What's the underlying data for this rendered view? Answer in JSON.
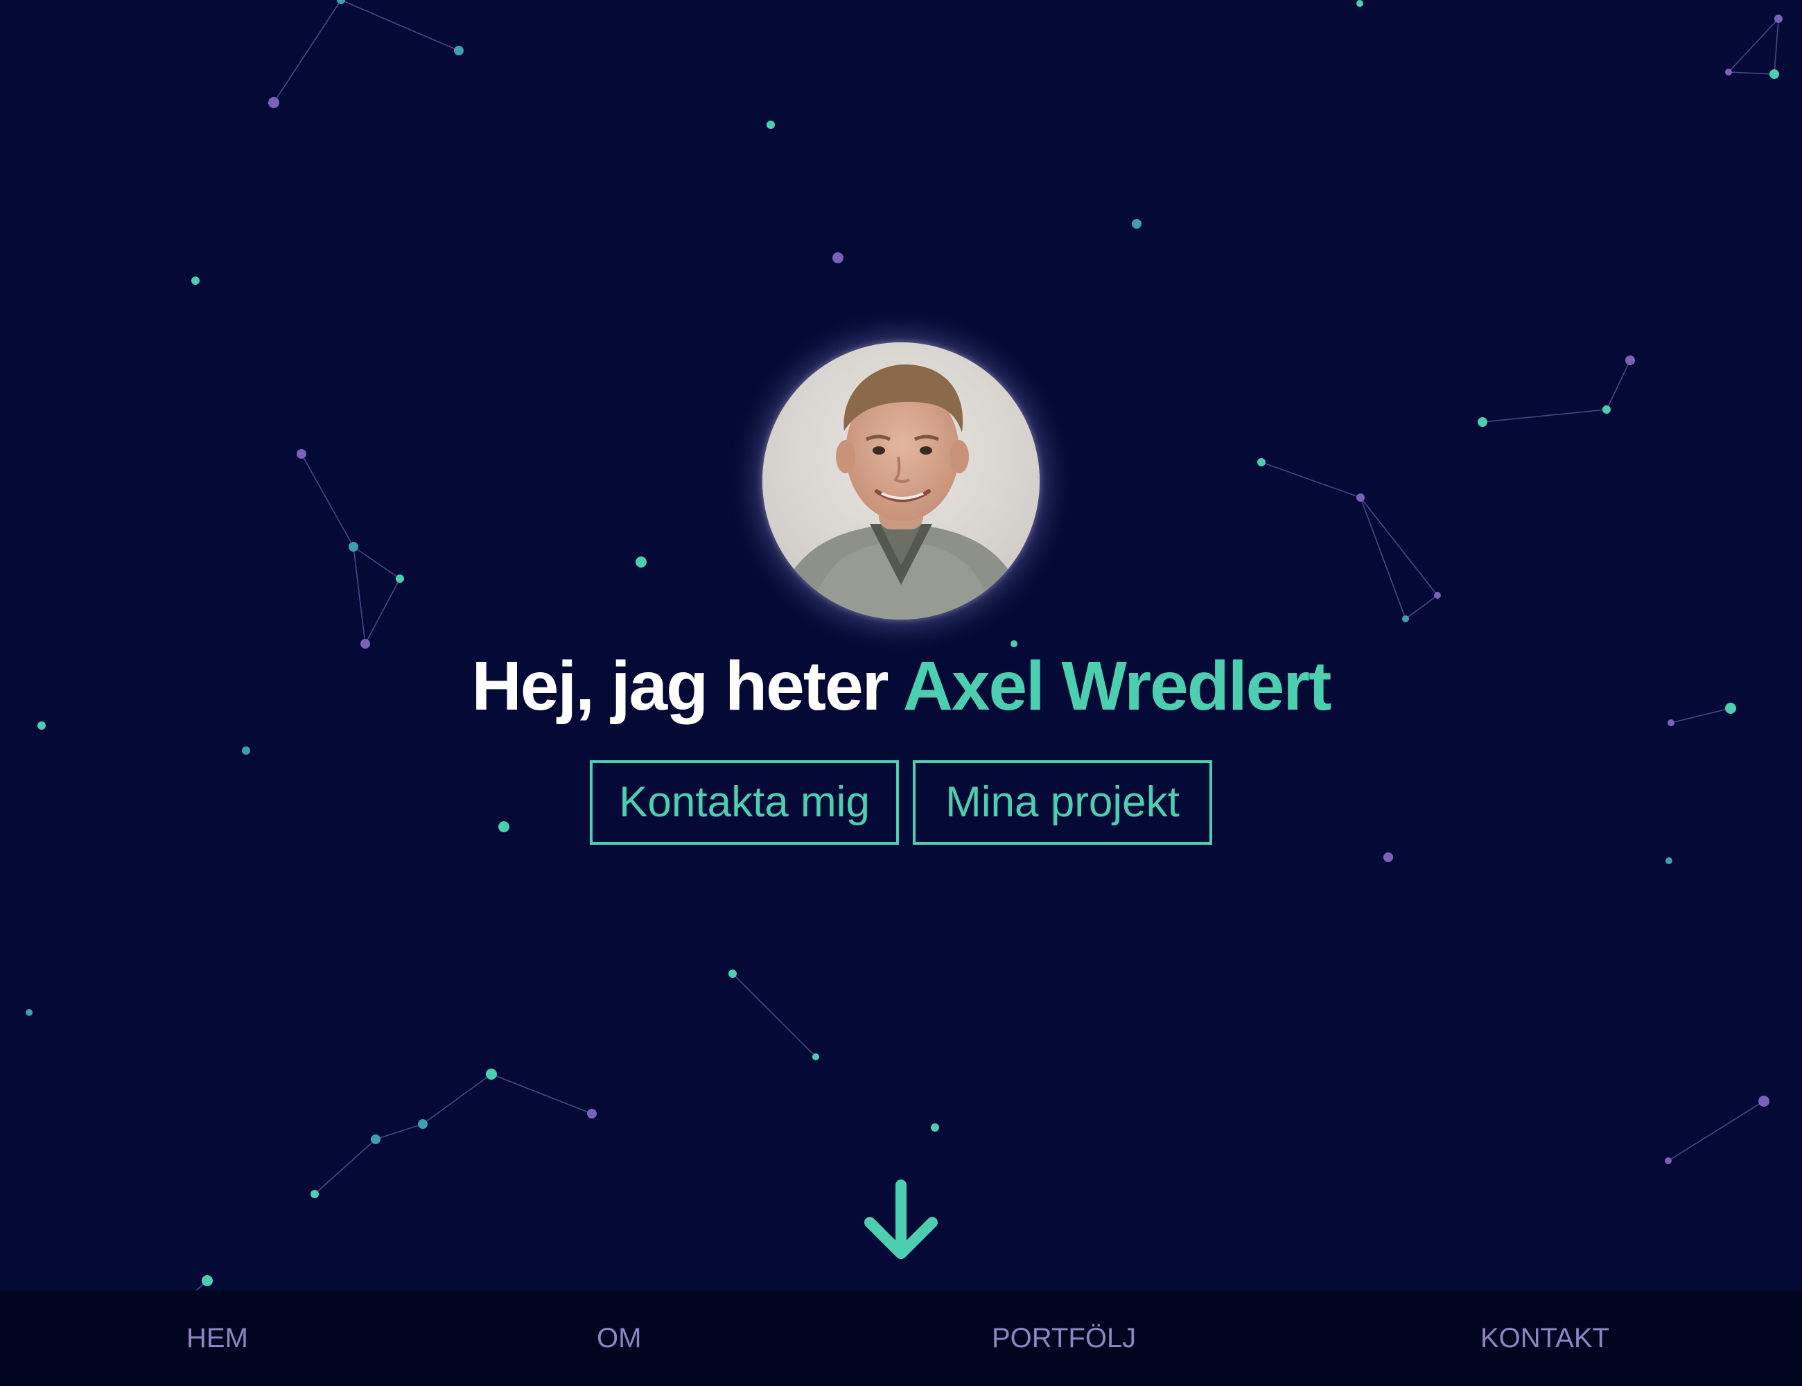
{
  "hero": {
    "greeting": "Hej, jag heter ",
    "name": "Axel Wredlert",
    "avatar_alt": "Porträtt av Axel Wredlert"
  },
  "buttons": {
    "contact_label": "Kontakta mig",
    "projects_label": "Mina projekt"
  },
  "scroll_icon": "arrow-down-icon",
  "nav": {
    "items": [
      {
        "label": "HEM"
      },
      {
        "label": "OM"
      },
      {
        "label": "PORTFÖLJ"
      },
      {
        "label": "KONTAKT"
      }
    ]
  },
  "colors": {
    "background": "#040a35",
    "accent": "#4ccfb0",
    "star_purple": "#7b62b8",
    "nav_background": "#02051f",
    "nav_text": "#8d84c2"
  }
}
